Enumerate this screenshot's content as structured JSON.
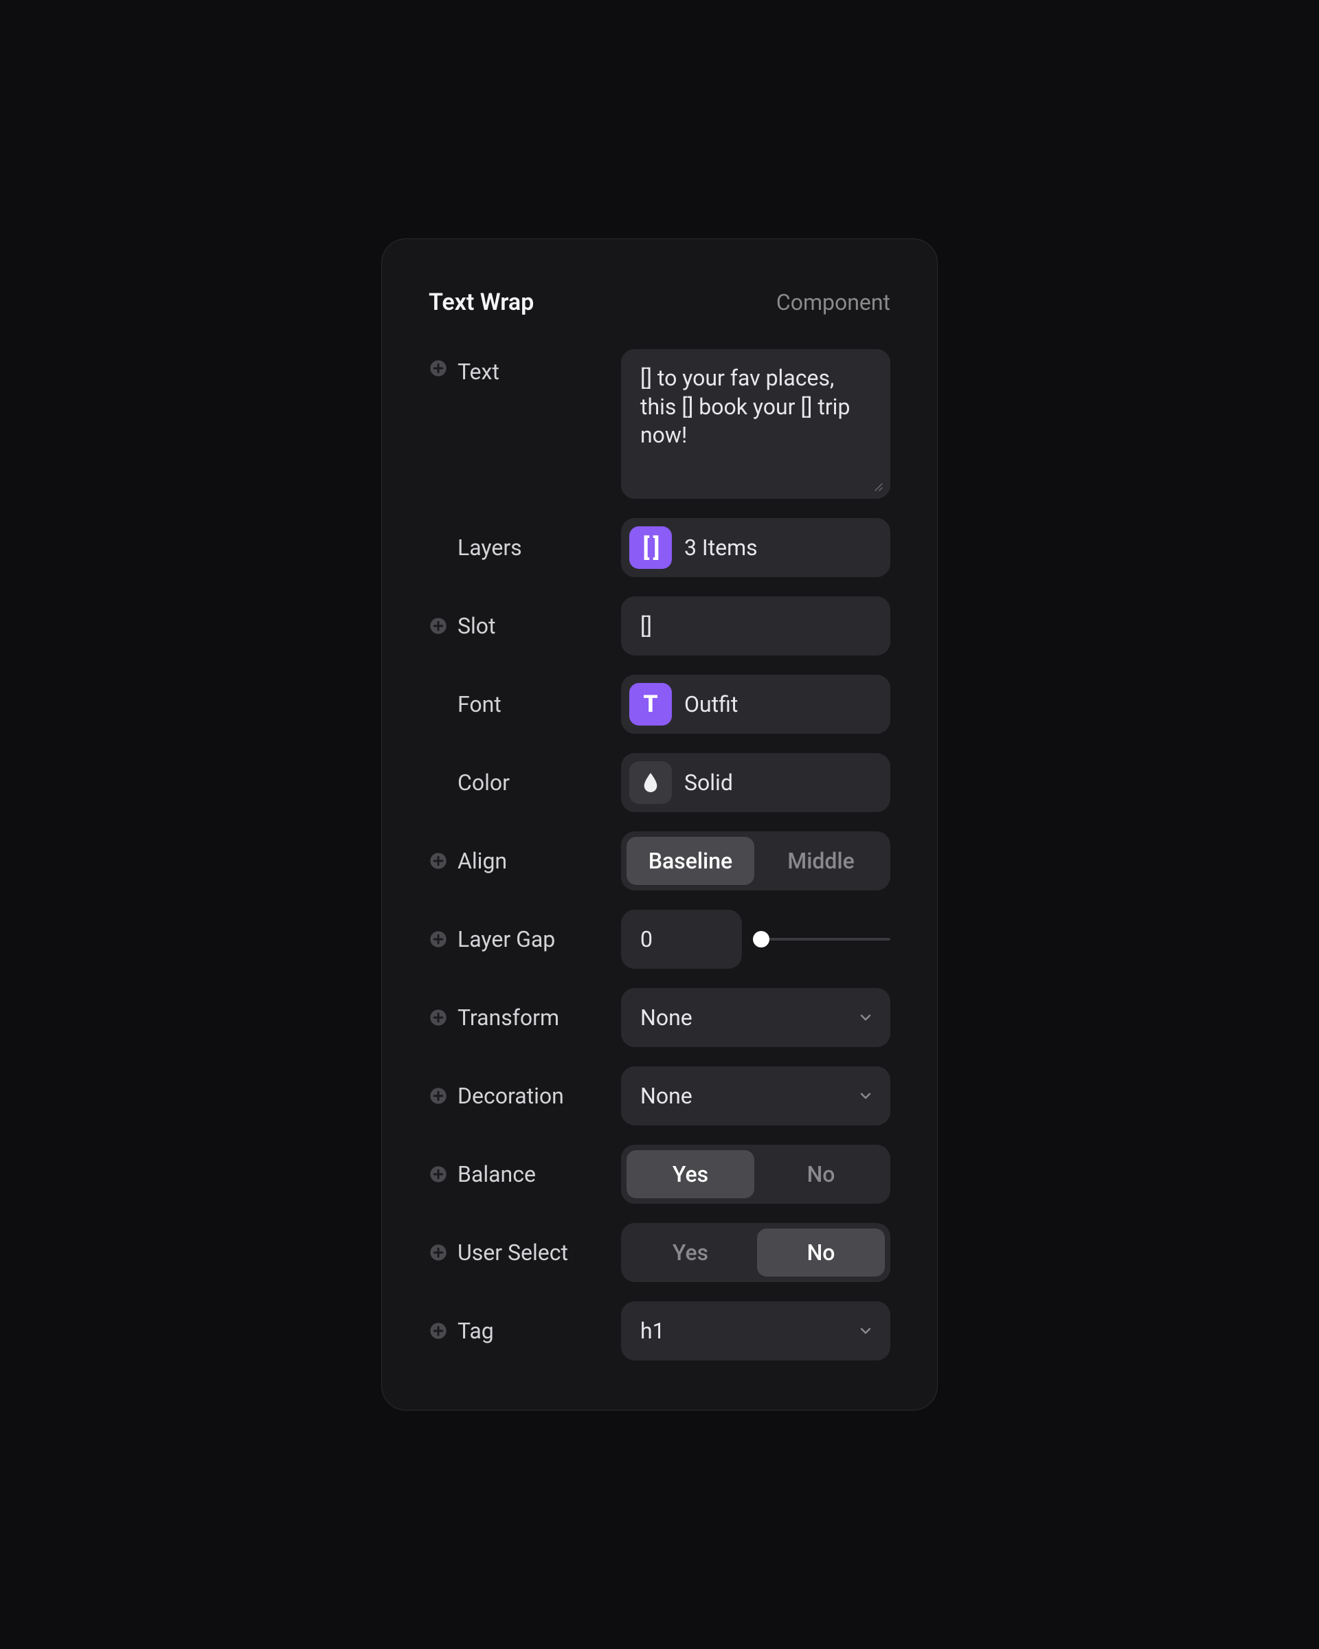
{
  "header": {
    "title": "Text Wrap",
    "type": "Component"
  },
  "fields": {
    "text": {
      "label": "Text",
      "value": "[] to your fav places, this [] book your [] trip now!"
    },
    "layers": {
      "label": "Layers",
      "value": "3 Items"
    },
    "slot": {
      "label": "Slot",
      "value": "[]"
    },
    "font": {
      "label": "Font",
      "value": "Outfit"
    },
    "color": {
      "label": "Color",
      "value": "Solid"
    },
    "align": {
      "label": "Align",
      "options": [
        "Baseline",
        "Middle"
      ],
      "selected": "Baseline"
    },
    "layerGap": {
      "label": "Layer Gap",
      "value": "0"
    },
    "transform": {
      "label": "Transform",
      "value": "None"
    },
    "decoration": {
      "label": "Decoration",
      "value": "None"
    },
    "balance": {
      "label": "Balance",
      "options": [
        "Yes",
        "No"
      ],
      "selected": "Yes"
    },
    "userSelect": {
      "label": "User Select",
      "options": [
        "Yes",
        "No"
      ],
      "selected": "No"
    },
    "tag": {
      "label": "Tag",
      "value": "h1"
    }
  }
}
